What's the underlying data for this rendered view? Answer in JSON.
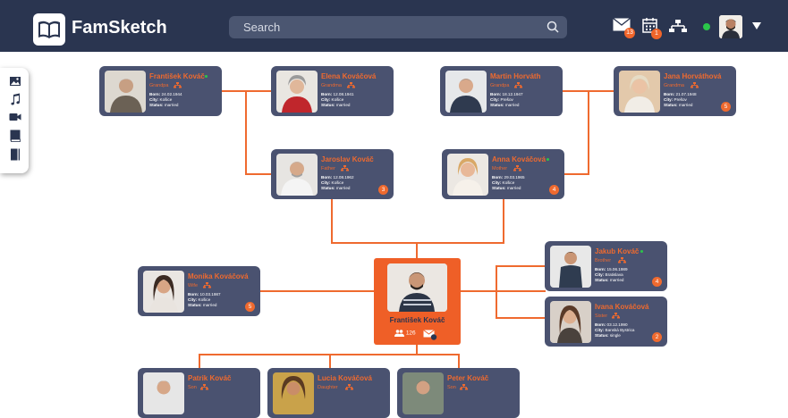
{
  "app": {
    "title": "FamSketch"
  },
  "search": {
    "placeholder": "Search"
  },
  "topbar": {
    "mail_badge": "13",
    "calendar_badge": "1"
  },
  "center": {
    "name": "František Kováč",
    "relatives_count": "126"
  },
  "cards": {
    "frantisek": {
      "name": "František Kováč",
      "relation": "Grandpa",
      "born": "24.02.1944",
      "city": "Košice",
      "status": "married",
      "count": ""
    },
    "elena": {
      "name": "Elena Kováčová",
      "relation": "Grandma",
      "born": "12.08.1941",
      "city": "Košice",
      "status": "married",
      "count": ""
    },
    "martin": {
      "name": "Martin Horváth",
      "relation": "Grandpa",
      "born": "18.12.1947",
      "city": "Prešov",
      "status": "married",
      "count": ""
    },
    "jana": {
      "name": "Jana Horváthová",
      "relation": "Grandma",
      "born": "21.07.1948",
      "city": "Prešov",
      "status": "married",
      "count": "5"
    },
    "jaroslav": {
      "name": "Jaroslav Kováč",
      "relation": "Father",
      "born": "12.08.1962",
      "city": "Košice",
      "status": "married",
      "count": "3"
    },
    "anna": {
      "name": "Anna Kováčová",
      "relation": "Mother",
      "born": "29.03.1965",
      "city": "Košice",
      "status": "married",
      "count": "4"
    },
    "monika": {
      "name": "Monika Kováčová",
      "relation": "Wife",
      "born": "10.03.1987",
      "city": "Košice",
      "status": "married",
      "count": "5"
    },
    "jakub": {
      "name": "Jakub Kováč",
      "relation": "Brother",
      "born": "15.06.1989",
      "city": "Bratislava",
      "status": "married",
      "count": "4"
    },
    "ivana": {
      "name": "Ivana Kováčová",
      "relation": "Sister",
      "born": "03.12.1990",
      "city": "Banská Bystrica",
      "status": "single",
      "count": "2"
    },
    "patrik": {
      "name": "Patrik Kováč",
      "relation": "Son",
      "born": "",
      "city": "",
      "status": "",
      "count": ""
    },
    "lucia": {
      "name": "Lucia Kováčová",
      "relation": "Daughter",
      "born": "",
      "city": "",
      "status": "",
      "count": ""
    },
    "peter": {
      "name": "Peter Kováč",
      "relation": "Son",
      "born": "",
      "city": "",
      "status": "",
      "count": ""
    }
  },
  "labels": {
    "born": "Born:",
    "city": "City:",
    "status": "Status:"
  }
}
